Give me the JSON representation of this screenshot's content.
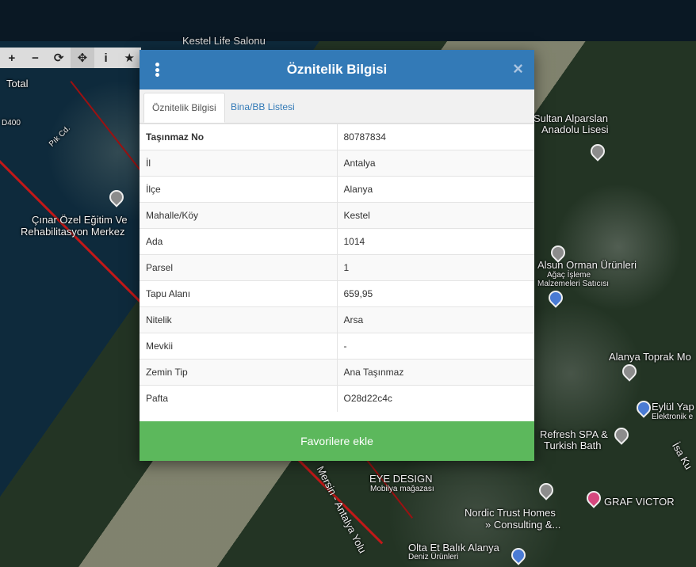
{
  "map": {
    "top_partial_label": "Kestel Life Salonu",
    "labels": [
      {
        "text": "Total",
        "cls": ""
      },
      {
        "text": "Pık Cd.",
        "cls": "rot2"
      },
      {
        "text": "Çınar Özel Eğitim Ve",
        "cls": ""
      },
      {
        "text": "Rehabilitasyon Merkez",
        "cls": ""
      },
      {
        "text": "Sultan Alparslan",
        "cls": ""
      },
      {
        "text": "Anadolu Lisesi",
        "cls": ""
      },
      {
        "text": "Alsun Orman Ürünleri",
        "cls": ""
      },
      {
        "text": "Ağaç İşleme",
        "cls": "small"
      },
      {
        "text": "Malzemeleri Satıcısı",
        "cls": "small"
      },
      {
        "text": "Alanya Toprak Mo",
        "cls": ""
      },
      {
        "text": "Eylül Yap",
        "cls": ""
      },
      {
        "text": "Elektronik e",
        "cls": "small"
      },
      {
        "text": "Refresh SPA &",
        "cls": ""
      },
      {
        "text": "Turkish Bath",
        "cls": ""
      },
      {
        "text": "İsa Ku",
        "cls": "rot3"
      },
      {
        "text": "EYE DESIGN",
        "cls": ""
      },
      {
        "text": "Mobilya mağazası",
        "cls": "small"
      },
      {
        "text": "Mersin - Antalya Yolu",
        "cls": "rot"
      },
      {
        "text": "Nordic Trust Homes",
        "cls": ""
      },
      {
        "text": "» Consulting &...",
        "cls": ""
      },
      {
        "text": "GRAF VICTOR",
        "cls": ""
      },
      {
        "text": "Olta Et Balık Alanya",
        "cls": ""
      },
      {
        "text": "Deniz Ürünleri",
        "cls": "small"
      },
      {
        "text": "D400",
        "cls": "small"
      }
    ]
  },
  "toolbar": {
    "tools": [
      {
        "name": "zoom-in-icon",
        "glyph": "+"
      },
      {
        "name": "zoom-out-icon",
        "glyph": "−"
      },
      {
        "name": "refresh-icon",
        "glyph": "⟳"
      },
      {
        "name": "pan-icon",
        "glyph": "✥"
      },
      {
        "name": "info-icon",
        "glyph": "i"
      },
      {
        "name": "star-icon",
        "glyph": "★"
      }
    ]
  },
  "modal": {
    "title": "Öznitelik Bilgisi",
    "close_glyph": "×",
    "tabs": [
      {
        "label": "Öznitelik Bilgisi",
        "active": true
      },
      {
        "label": "Bina/BB Listesi",
        "active": false
      }
    ],
    "rows": [
      {
        "key": "Taşınmaz No",
        "value": "80787834"
      },
      {
        "key": "İl",
        "value": "Antalya"
      },
      {
        "key": "İlçe",
        "value": "Alanya"
      },
      {
        "key": "Mahalle/Köy",
        "value": "Kestel"
      },
      {
        "key": "Ada",
        "value": "1014"
      },
      {
        "key": "Parsel",
        "value": "1"
      },
      {
        "key": "Tapu Alanı",
        "value": "659,95"
      },
      {
        "key": "Nitelik",
        "value": "Arsa"
      },
      {
        "key": "Mevkii",
        "value": "-"
      },
      {
        "key": "Zemin Tip",
        "value": "Ana Taşınmaz"
      },
      {
        "key": "Pafta",
        "value": "O28d22c4c"
      }
    ],
    "favorite_button": "Favorilere ekle"
  }
}
